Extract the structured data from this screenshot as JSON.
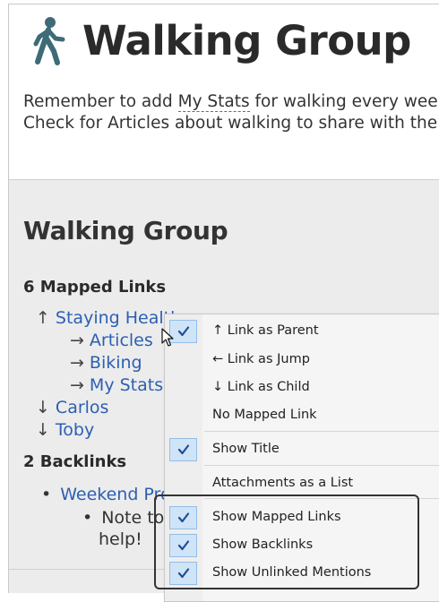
{
  "note": {
    "title": "Walking Group",
    "line1_prefix": "Remember to add ",
    "line1_link": "My Stats",
    "line1_suffix": " for walking every week",
    "line2": "Check for Articles about walking to share with the"
  },
  "map_panel": {
    "title": "Walking Group",
    "mapped_heading": "6 Mapped Links",
    "mapped_links": [
      {
        "arrow": "↑",
        "label": "Staying Healthy"
      },
      {
        "arrow": "→",
        "label": "Articles"
      },
      {
        "arrow": "→",
        "label": "Biking"
      },
      {
        "arrow": "→",
        "label": "My Stats"
      },
      {
        "arrow": "↓",
        "label": "Carlos"
      },
      {
        "arrow": "↓",
        "label": "Toby"
      }
    ],
    "backlinks_heading": "2 Backlinks",
    "backlinks": [
      {
        "bullet": "•",
        "label": "Weekend Pro"
      }
    ],
    "backlink_subnote": {
      "bullet": "•",
      "line1": "Note to",
      "line2": "help!"
    }
  },
  "context_menu": {
    "items": [
      {
        "label": "↑ Link as Parent",
        "checked": true
      },
      {
        "label": "← Link as Jump",
        "checked": false
      },
      {
        "label": "↓ Link as Child",
        "checked": false
      },
      {
        "label": "No Mapped Link",
        "checked": false
      },
      {
        "label": "Show Title",
        "checked": true
      },
      {
        "label": "Attachments as a List",
        "checked": false
      },
      {
        "label": "Show Mapped Links",
        "checked": true
      },
      {
        "label": "Show Backlinks",
        "checked": true
      },
      {
        "label": "Show Unlinked Mentions",
        "checked": true
      }
    ]
  },
  "icons": {
    "title_icon": "walking-person-icon",
    "check_icon": "checkmark-icon",
    "cursor_icon": "mouse-pointer-icon"
  },
  "colors": {
    "link": "#2c5fb3",
    "walker_icon": "#3d6b78",
    "panel_bg": "#ececec",
    "check_bg": "#cfe4f7",
    "check_border": "#93bde6",
    "check_mark": "#1f4f99"
  }
}
